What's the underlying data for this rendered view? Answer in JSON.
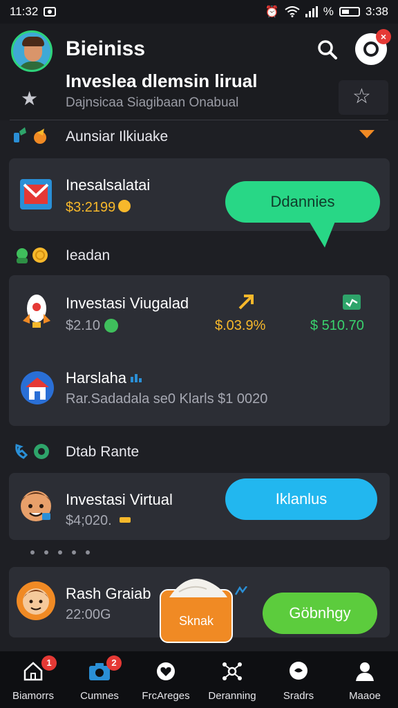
{
  "status_bar": {
    "time_left": "11:32",
    "signal_text": "%",
    "time_right": "3:38"
  },
  "header": {
    "app_title": "Bieiniss",
    "headline": "Inveslea dlemsin lirual",
    "subline": "Dajnsicaa Siagibaan Onabual"
  },
  "sections": {
    "s1": {
      "title": "Aunsiar Ilkiuake"
    },
    "s2": {
      "title": "Ieadan"
    },
    "s3": {
      "title": "Dtab Rante"
    }
  },
  "card1": {
    "title": "Inesalsalatai",
    "amount": "$3:2199",
    "button_label": "Ddannies"
  },
  "card2": {
    "row1": {
      "title": "Investasi Viugalad",
      "value": "$2.10",
      "percent": "$.03.9%",
      "amount": "$ 510.70"
    },
    "row2": {
      "title": "Harslaha",
      "detail": "Rar.Sadadala se0 Klarls $1 0020"
    }
  },
  "card3": {
    "title": "Investasi Virtual",
    "amount": "$4;020.",
    "button_label": "Iklanlus"
  },
  "card4": {
    "title": "Rash Graiab",
    "amount": "22:00G",
    "badge_label": "Sknak",
    "button_label": "Göbnhgy"
  },
  "nav": {
    "items": [
      {
        "label": "Biamorrs",
        "icon": "home-icon",
        "badge": "1"
      },
      {
        "label": "Cumnes",
        "icon": "camera-icon",
        "badge": "2"
      },
      {
        "label": "FrcAreges",
        "icon": "heart-chat-icon"
      },
      {
        "label": "Deranning",
        "icon": "network-icon"
      },
      {
        "label": "Sradrs",
        "icon": "chat-icon"
      },
      {
        "label": "Maaoe",
        "icon": "profile-icon"
      }
    ]
  },
  "colors": {
    "accent_green": "#28d786",
    "accent_blue": "#22b7ef",
    "accent_lime": "#5ccc3d",
    "gold": "#f7b82b",
    "badge_red": "#e53935",
    "orange": "#f08a24"
  }
}
